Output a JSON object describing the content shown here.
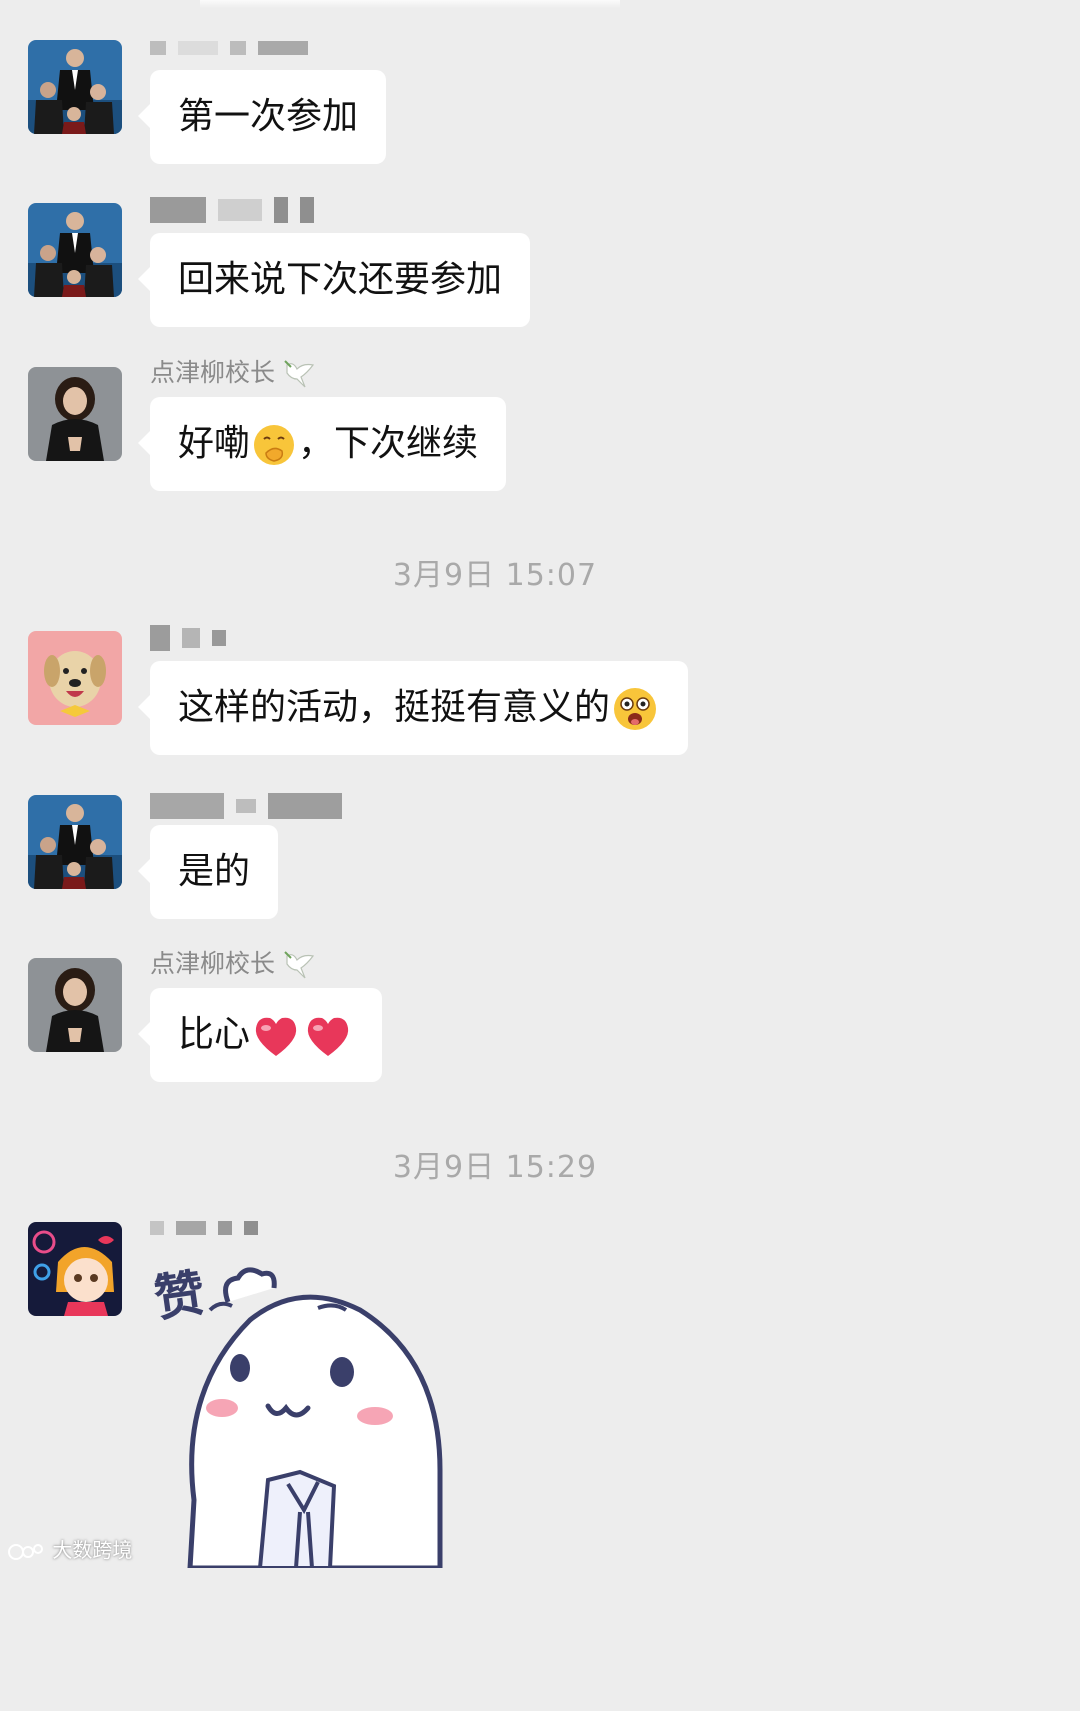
{
  "messages": [
    {
      "sender": "",
      "text": "第一次参加",
      "avatar": "family-photo-avatar"
    },
    {
      "sender": "",
      "text": "回来说下次还要参加",
      "avatar": "family-photo-avatar"
    },
    {
      "sender": "点津柳校长",
      "text": "好嘞",
      "text_after": "，下次继续",
      "avatar": "principal-portrait-avatar"
    },
    {
      "sender": "",
      "text": "这样的活动，挺挺有意义的",
      "avatar": "dog-avatar"
    },
    {
      "sender": "",
      "text": "是的",
      "avatar": "family-photo-avatar"
    },
    {
      "sender": "点津柳校长",
      "text": "比心",
      "avatar": "principal-portrait-avatar"
    },
    {
      "sender": "",
      "sticker_text": "赞",
      "avatar": "cartoon-girl-avatar"
    }
  ],
  "timestamps": [
    "3月9日 15:07",
    "3月9日 15:29"
  ],
  "watermark": "大数跨境",
  "colors": {
    "background": "#ededed",
    "bubble": "#ffffff",
    "meta_text": "#a9a9a9"
  }
}
